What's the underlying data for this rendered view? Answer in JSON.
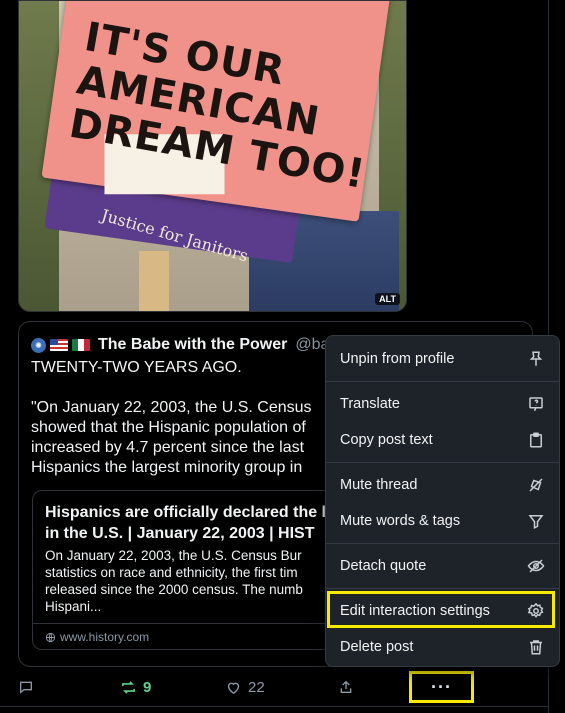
{
  "photo": {
    "sign_text": [
      "IT'S OUR",
      "AMERICAN",
      "DREAM TOO!"
    ],
    "sign_subtext": "Justice for Janitors",
    "alt_badge": "ALT"
  },
  "quote": {
    "display_name": "The Babe with the Power",
    "handle": "@bab",
    "body": "TWENTY-TWO YEARS AGO.\n\n\"On January 22, 2003, the U.S. Census\nshowed that the Hispanic population of\nincreased by 4.7 percent since the last\nHispanics the largest minority group in",
    "link_card": {
      "title": "Hispanics are officially declared the l\nin the U.S. | January 22, 2003 | HIST",
      "description": "On January 22, 2003, the U.S. Census Bur\nstatistics on race and ethnicity, the first tim\nreleased since the 2000 census. The numb\nHispani...",
      "domain": "www.history.com"
    }
  },
  "actions": {
    "reply_count": "",
    "repost_count": "9",
    "like_count": "22",
    "more_label": "···"
  },
  "menu": {
    "items": [
      {
        "label": "Unpin from profile",
        "icon": "pin-icon"
      },
      {
        "label": "Translate",
        "icon": "translate-icon"
      },
      {
        "label": "Copy post text",
        "icon": "clipboard-icon"
      },
      {
        "label": "Mute thread",
        "icon": "mute-thread-icon"
      },
      {
        "label": "Mute words & tags",
        "icon": "filter-icon"
      },
      {
        "label": "Detach quote",
        "icon": "eye-off-icon"
      },
      {
        "label": "Edit interaction settings",
        "icon": "gear-icon"
      },
      {
        "label": "Delete post",
        "icon": "trash-icon"
      }
    ]
  },
  "colors": {
    "background": "#000000",
    "menu_bg": "#1e2329",
    "repost_green": "#5cd68a",
    "highlight_yellow": "#f5ea00",
    "muted_text": "#8b98a5"
  }
}
